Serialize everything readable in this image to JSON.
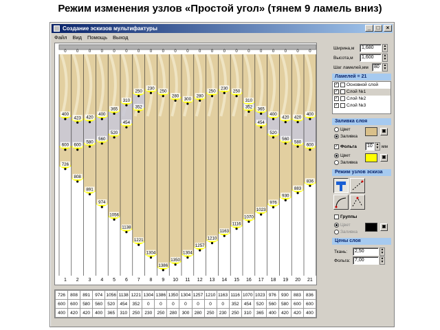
{
  "page_title": "Режим изменения узлов «Простой угол» (тянем 9 ламель вниз)",
  "window": {
    "title": "Создание эскизов мультифактуры",
    "menu": [
      "Файл",
      "Вид",
      "Помощь",
      "Выход"
    ],
    "controls": [
      "_",
      "□",
      "×"
    ]
  },
  "canvas": {
    "lamel_numbers": [
      "1",
      "2",
      "3",
      "4",
      "5",
      "6",
      "7",
      "8",
      "9",
      "10",
      "11",
      "12",
      "13",
      "14",
      "15",
      "16",
      "17",
      "18",
      "19",
      "20",
      "21"
    ],
    "top_marker": "0",
    "nodes": {
      "row1": [
        "400",
        "423",
        "420",
        "400",
        "365",
        "310",
        "250",
        "230",
        "250",
        "280",
        "300",
        "280",
        "250",
        "230",
        "250",
        "310",
        "365",
        "400",
        "420",
        "420",
        "400"
      ],
      "row2": [
        "600",
        "600",
        "580",
        "560",
        "520",
        "454",
        "352",
        "",
        "",
        "",
        "",
        "",
        "",
        "",
        "",
        "352",
        "454",
        "520",
        "560",
        "580",
        "600"
      ],
      "row3": [
        "726",
        "808",
        "891",
        "974",
        "1056",
        "1138",
        "1221",
        "1304",
        "1386",
        "1350",
        "1304",
        "1257",
        "1210",
        "1163",
        "1116",
        "1070",
        "1023",
        "976",
        "930",
        "883",
        "836"
      ]
    },
    "colors": {
      "strip": "#e2cfa0",
      "strip_light": "#f2e8cc",
      "band": "#ffff00",
      "band2": "#c8c8d8",
      "line": "#202020"
    }
  },
  "table": {
    "rows": [
      [
        "726",
        "808",
        "891",
        "974",
        "1056",
        "1138",
        "1221",
        "1304",
        "1386",
        "1350",
        "1304",
        "1257",
        "1210",
        "1163",
        "1116",
        "1070",
        "1023",
        "976",
        "930",
        "883",
        "836"
      ],
      [
        "600",
        "600",
        "580",
        "560",
        "520",
        "454",
        "352",
        "0",
        "0",
        "0",
        "0",
        "0",
        "0",
        "0",
        "352",
        "454",
        "520",
        "560",
        "580",
        "600",
        "600"
      ],
      [
        "400",
        "420",
        "420",
        "400",
        "365",
        "310",
        "250",
        "230",
        "250",
        "280",
        "300",
        "280",
        "250",
        "230",
        "250",
        "310",
        "365",
        "400",
        "420",
        "420",
        "400"
      ]
    ]
  },
  "panel": {
    "width_label": "Ширина,м",
    "width_value": "1,680",
    "height_label": "Высота,м",
    "height_value": "1,600",
    "step_label": "Шаг ламелей,мм",
    "step_value": "80",
    "lamels_header": "Ламелей = 21",
    "layers": [
      {
        "label": "Основной слой",
        "checked": true
      },
      {
        "label": "Слой №1",
        "checked": true
      },
      {
        "label": "Слой №2",
        "checked": true
      },
      {
        "label": "Слой №3",
        "checked": true
      }
    ],
    "fill_header": "Заливка слоя",
    "fill_color": "Цвет",
    "fill_fill": "Заливка",
    "foil_label": "Фольга",
    "foil_value": "10",
    "foil_unit": "мм",
    "foil_color": "Цвет",
    "foil_fill": "Заливка",
    "mode_header": "Режим узлов эскиза",
    "group_label": "Группы",
    "group_color": "Цвет",
    "group_fill": "Заливка",
    "prices_header": "Цены слоя",
    "fabric_label": "Ткань:",
    "fabric_value": "2,50",
    "foil_price_label": "Фольга:",
    "foil_price_value": "7,00",
    "colors": {
      "fill_swatch": "#d9c08a",
      "foil_swatch": "#ffff00",
      "group_swatch": "#000000",
      "header_bg": "#a6caf0"
    }
  }
}
